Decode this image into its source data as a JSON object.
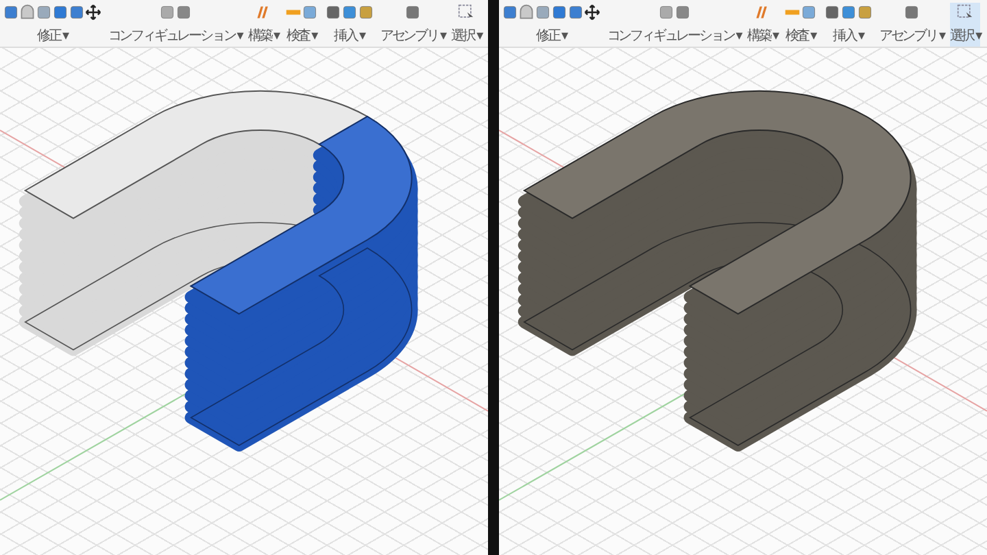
{
  "panels": [
    {
      "toolbar": {
        "groups": [
          {
            "label": "修正 ▾",
            "selected": false
          },
          {
            "label": "コンフィギュレーション ▾",
            "selected": false
          },
          {
            "label": "構築 ▾",
            "selected": false
          },
          {
            "label": "検査 ▾",
            "selected": false
          },
          {
            "label": "挿入 ▾",
            "selected": false
          },
          {
            "label": "アセンブリ ▾",
            "selected": false
          },
          {
            "label": "選択 ▾",
            "selected": false
          }
        ]
      },
      "view": {
        "kind": "transparent"
      }
    },
    {
      "toolbar": {
        "groups": [
          {
            "label": "修正 ▾",
            "selected": false
          },
          {
            "label": "コンフィギュレーション ▾",
            "selected": false
          },
          {
            "label": "構築 ▾",
            "selected": false
          },
          {
            "label": "検査 ▾",
            "selected": false
          },
          {
            "label": "挿入 ▾",
            "selected": false
          },
          {
            "label": "アセンブリ ▾",
            "selected": false
          },
          {
            "label": "選択 ▾",
            "selected": true
          }
        ]
      },
      "view": {
        "kind": "solid"
      }
    }
  ]
}
